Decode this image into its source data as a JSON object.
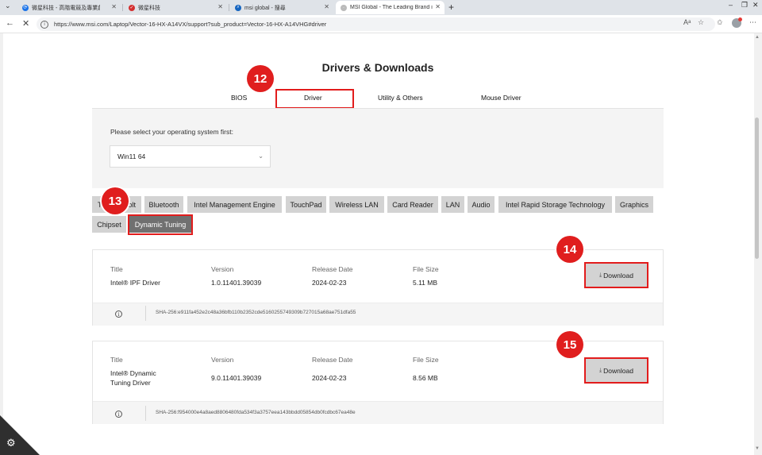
{
  "browser": {
    "tabs": [
      {
        "label": "微星科技 - 高階電競及專業創作筆電",
        "favicon_color": "#1a73e8",
        "favicon": "⟳",
        "active": false
      },
      {
        "label": "微星科技",
        "favicon_color": "#d32f2f",
        "favicon": "✓",
        "active": false
      },
      {
        "label": "msi global - 搜尋",
        "favicon_color": "#1565c0",
        "favicon": "⌕",
        "active": false
      },
      {
        "label": "MSI Global - The Leading Brand in",
        "favicon_color": "#888888",
        "favicon": "·",
        "active": true
      }
    ],
    "new_tab": "+",
    "url": "https://www.msi.com/Laptop/Vector-16-HX-A14VX/support?sub_product=Vector-16-HX-A14VHG#driver",
    "icons": [
      "back-icon",
      "reload-icon",
      "read-aloud-icon",
      "favorite-icon",
      "extensions-icon",
      "profile-icon",
      "more-icon"
    ]
  },
  "page": {
    "title": "Drivers & Downloads",
    "tabs": [
      "BIOS",
      "Driver",
      "Utility & Others",
      "Mouse Driver"
    ],
    "os_label": "Please select your operating system first:",
    "os_value": "Win11 64",
    "categories_row1": [
      "Thunderbolt",
      "Bluetooth",
      "Intel Management Engine",
      "TouchPad",
      "Wireless LAN",
      "Card Reader",
      "LAN",
      "Audio",
      "Intel Rapid Storage Technology",
      "Graphics"
    ],
    "categories_row2": [
      "Chipset",
      "Dynamic Tuning"
    ],
    "columns": {
      "title": "Title",
      "version": "Version",
      "release_date": "Release Date",
      "file_size": "File Size"
    },
    "download_label": "Download",
    "drivers": [
      {
        "title": "Intel® IPF Driver",
        "version": "1.0.11401.39039",
        "release_date": "2024-02-23",
        "file_size": "5.11 MB",
        "sha": "SHA-256:e911fa452e2c48a36bfb110b2352cde5160255749309b727015a68ae751dfa55"
      },
      {
        "title": "Intel® Dynamic Tuning Driver",
        "title_line1": "Intel® Dynamic",
        "title_line2": "Tuning Driver",
        "version": "9.0.11401.39039",
        "release_date": "2024-02-23",
        "file_size": "8.56 MB",
        "sha": "SHA-256:f954000e4a8aed8806480fda534f3a3757eea143bbdd05854db0fcdbc67ea48e"
      }
    ]
  },
  "annotations": [
    "12",
    "13",
    "14",
    "15"
  ],
  "colors": {
    "highlight": "#e21c1c",
    "chip": "#d3d3d3",
    "chip_active": "#707070",
    "panel": "#f4f4f4"
  }
}
